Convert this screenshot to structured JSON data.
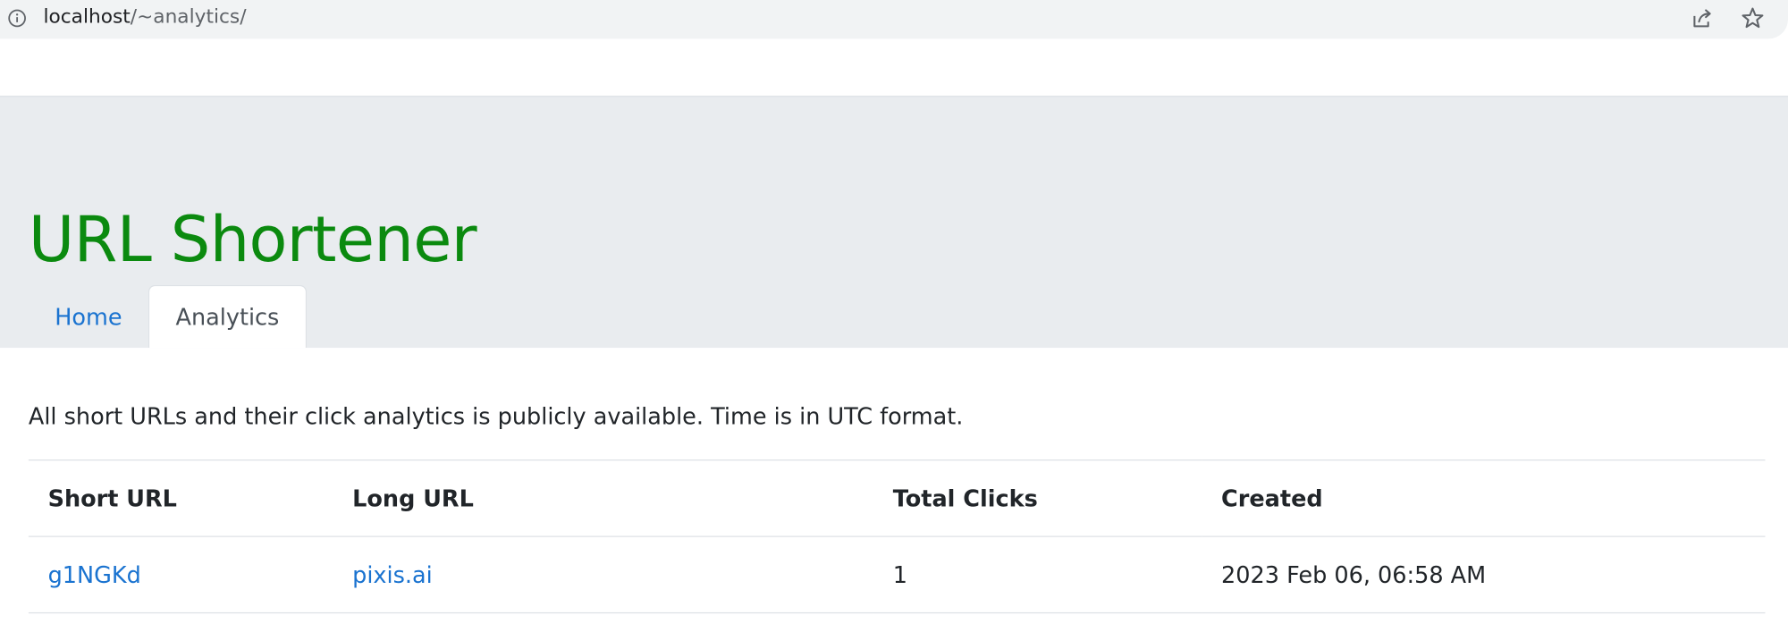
{
  "browser": {
    "url_host": "localhost",
    "url_path": "/~analytics/"
  },
  "header": {
    "title": "URL Shortener",
    "title_color": "#0b8a0f",
    "tabs": [
      {
        "label": "Home",
        "active": false
      },
      {
        "label": "Analytics",
        "active": true
      }
    ]
  },
  "main": {
    "intro": "All short URLs and their click analytics is publicly available. Time is in UTC format.",
    "table": {
      "columns": [
        "Short URL",
        "Long URL",
        "Total Clicks",
        "Created"
      ],
      "rows": [
        {
          "short_url": "g1NGKd",
          "long_url": "pixis.ai",
          "total_clicks": "1",
          "created": "2023 Feb 06, 06:58 AM"
        }
      ]
    }
  },
  "colors": {
    "link": "#1a73d0",
    "header_bg": "#e9ecef"
  }
}
